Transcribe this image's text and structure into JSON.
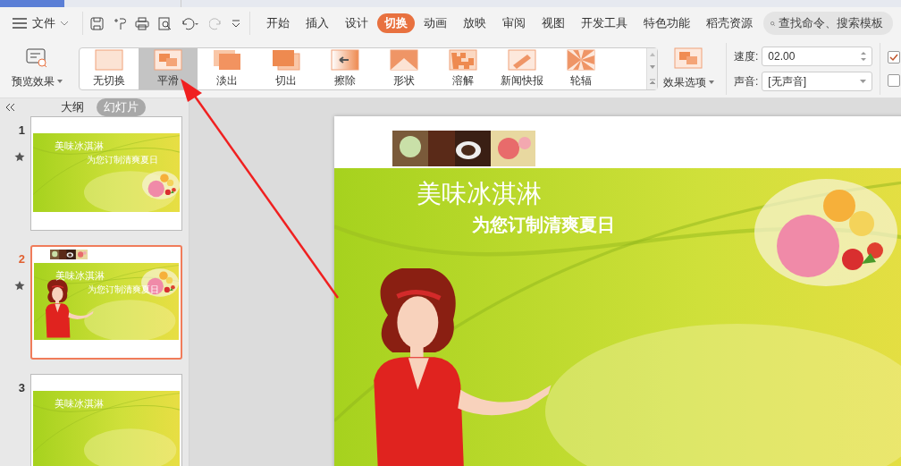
{
  "menu": {
    "file": "文件",
    "tabs": [
      {
        "label": "开始",
        "selected": false
      },
      {
        "label": "插入",
        "selected": false
      },
      {
        "label": "设计",
        "selected": false
      },
      {
        "label": "切换",
        "selected": true
      },
      {
        "label": "动画",
        "selected": false
      },
      {
        "label": "放映",
        "selected": false
      },
      {
        "label": "审阅",
        "selected": false
      },
      {
        "label": "视图",
        "selected": false
      },
      {
        "label": "开发工具",
        "selected": false
      },
      {
        "label": "特色功能",
        "selected": false
      },
      {
        "label": "稻壳资源",
        "selected": false
      }
    ],
    "search": {
      "placeholder": "查找命令、搜索模板"
    }
  },
  "ribbon": {
    "preview": "预览效果",
    "effects": [
      {
        "label": "无切换",
        "kind": "none",
        "selected": false
      },
      {
        "label": "平滑",
        "kind": "smooth",
        "selected": true
      },
      {
        "label": "淡出",
        "kind": "fade",
        "selected": false
      },
      {
        "label": "切出",
        "kind": "cut",
        "selected": false
      },
      {
        "label": "擦除",
        "kind": "wipe",
        "selected": false
      },
      {
        "label": "形状",
        "kind": "shape",
        "selected": false
      },
      {
        "label": "溶解",
        "kind": "dissolve",
        "selected": false
      },
      {
        "label": "新闻快报",
        "kind": "news",
        "selected": false
      },
      {
        "label": "轮辐",
        "kind": "spoke",
        "selected": false
      }
    ],
    "options": "效果选项",
    "speed": {
      "label": "速度:",
      "value": "02.00"
    },
    "sound": {
      "label": "声音:",
      "value": "[无声音]"
    },
    "checkboxes": [
      {
        "checked": true
      },
      {
        "checked": false
      }
    ]
  },
  "panel": {
    "tabs": [
      {
        "label": "大纲",
        "selected": false
      },
      {
        "label": "幻灯片",
        "selected": true
      }
    ],
    "slides": [
      {
        "number": "1",
        "selected": false,
        "transition": true,
        "title": "美味冰淇淋",
        "subtitle": "为您订制清爽夏日"
      },
      {
        "number": "2",
        "selected": true,
        "transition": true,
        "title": "美味冰淇淋",
        "subtitle": "为您订制清爽夏日"
      },
      {
        "number": "3",
        "selected": false,
        "transition": false,
        "title": "美味冰淇淋"
      }
    ]
  },
  "slide": {
    "title": "美味冰淇淋",
    "subtitle": "为您订制清爽夏日"
  }
}
